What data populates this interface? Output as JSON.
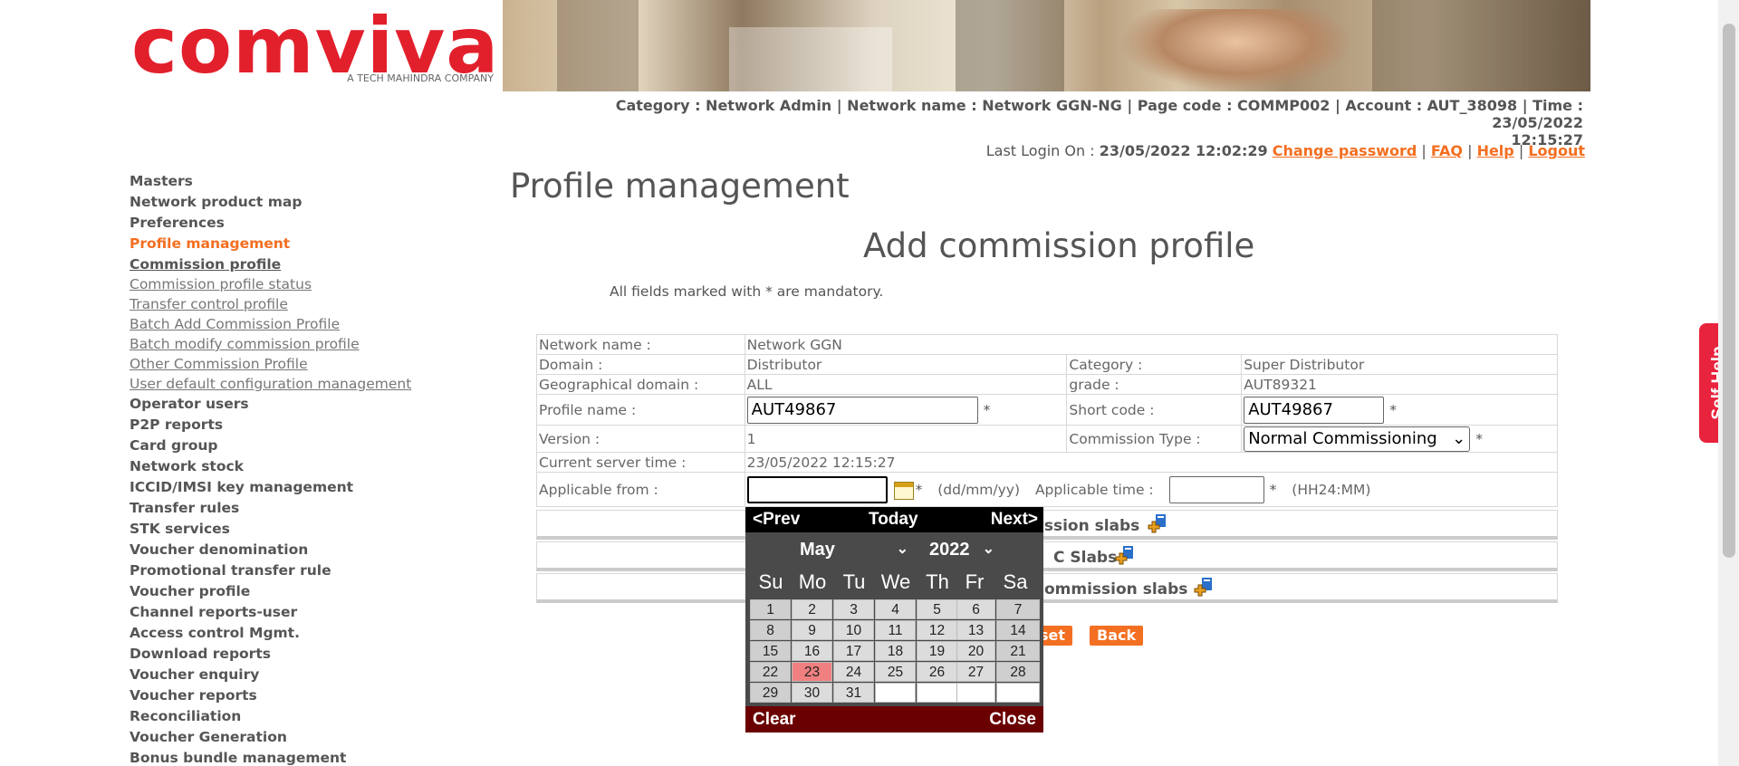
{
  "logo": {
    "name": "comviva",
    "tagline": "A TECH MAHINDRA COMPANY"
  },
  "info": {
    "line1": "Category : Network Admin | Network name : Network GGN-NG | Page code : COMMP002 | Account : AUT_38098 | Time : 23/05/2022",
    "line2": "12:15:27"
  },
  "login": {
    "label": "Last Login On : ",
    "datetime": "23/05/2022 12:02:29",
    "change_password": "Change password",
    "faq": "FAQ",
    "help": "Help",
    "logout": "Logout",
    "sep": "|"
  },
  "sidebar": {
    "items": [
      {
        "label": "Masters"
      },
      {
        "label": "Network product map"
      },
      {
        "label": "Preferences"
      },
      {
        "label": "Profile management"
      },
      {
        "label": "Commission profile"
      },
      {
        "label": "Commission profile status"
      },
      {
        "label": "Transfer control profile"
      },
      {
        "label": "Batch Add Commission Profile"
      },
      {
        "label": "Batch modify commission profile"
      },
      {
        "label": "Other Commission Profile"
      },
      {
        "label": "User default configuration management"
      },
      {
        "label": "Operator users"
      },
      {
        "label": "P2P reports"
      },
      {
        "label": "Card group"
      },
      {
        "label": "Network stock"
      },
      {
        "label": "ICCID/IMSI key management"
      },
      {
        "label": "Transfer rules"
      },
      {
        "label": "STK services"
      },
      {
        "label": "Voucher denomination"
      },
      {
        "label": "Promotional transfer rule"
      },
      {
        "label": "Voucher profile"
      },
      {
        "label": "Channel reports-user"
      },
      {
        "label": "Access control Mgmt."
      },
      {
        "label": "Download reports"
      },
      {
        "label": "Voucher enquiry"
      },
      {
        "label": "Voucher reports"
      },
      {
        "label": "Reconciliation"
      },
      {
        "label": "Voucher Generation"
      },
      {
        "label": "Bonus bundle management"
      }
    ]
  },
  "page": {
    "title": "Profile management",
    "form_title": "Add commission profile",
    "mandatory_note": "All fields marked with * are mandatory."
  },
  "form": {
    "network_name_label": "Network name :",
    "network_name": "Network GGN",
    "domain_label": "Domain :",
    "domain": "Distributor",
    "category_label": "Category :",
    "category": "Super Distributor",
    "geo_label": "Geographical domain :",
    "geo": "ALL",
    "grade_label": "grade :",
    "grade": "AUT89321",
    "profile_name_label": "Profile name :",
    "profile_name": "AUT49867",
    "short_code_label": "Short code :",
    "short_code": "AUT49867",
    "version_label": "Version :",
    "version": "1",
    "commission_type_label": "Commission Type :",
    "commission_type": "Normal Commissioning",
    "server_time_label": "Current server time :",
    "server_time": "23/05/2022 12:15:27",
    "applicable_from_label": "Applicable from :",
    "applicable_from": "",
    "date_format": "(dd/mm/yy)",
    "applicable_time_label": "Applicable time :",
    "applicable_time": "",
    "time_format": "(HH24:MM)",
    "star": "*"
  },
  "slabs": {
    "row1": "ission slabs",
    "row2": "C Slabs",
    "row3": "ommission slabs"
  },
  "buttons": {
    "reset": "set",
    "back": "Back"
  },
  "calendar": {
    "prev": "<Prev",
    "today": "Today",
    "next": "Next>",
    "month": "May",
    "year": "2022",
    "dows": [
      "Su",
      "Mo",
      "Tu",
      "We",
      "Th",
      "Fr",
      "Sa"
    ],
    "weeks": [
      [
        "1",
        "2",
        "3",
        "4",
        "5",
        "6",
        "7"
      ],
      [
        "8",
        "9",
        "10",
        "11",
        "12",
        "13",
        "14"
      ],
      [
        "15",
        "16",
        "17",
        "18",
        "19",
        "20",
        "21"
      ],
      [
        "22",
        "23",
        "24",
        "25",
        "26",
        "27",
        "28"
      ],
      [
        "29",
        "30",
        "31",
        "",
        "",
        "",
        ""
      ]
    ],
    "selected": "23",
    "clear": "Clear",
    "close": "Close"
  },
  "self_help": "Self Help",
  "colors": {
    "accent": "#f36f21",
    "brand": "#e2202c",
    "today": "#f08080"
  }
}
